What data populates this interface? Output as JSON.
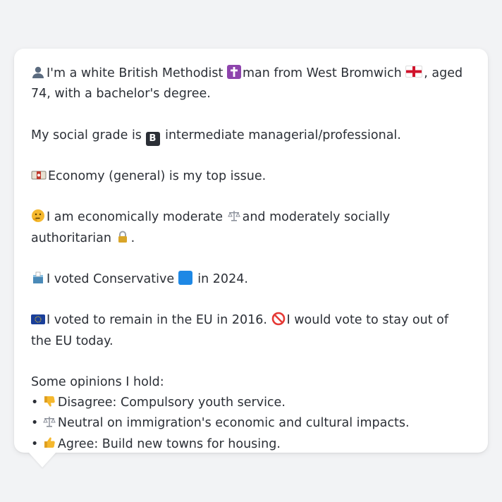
{
  "persona": {
    "line1_pre": "I'm a white British Methodist",
    "line1_mid": "man from West Bromwich",
    "line1_post": ", aged 74, with a bachelor's degree.",
    "social_grade_pre": "My social grade is",
    "social_grade_post": "intermediate managerial/professional.",
    "top_issue": "Economy (general) is my top issue.",
    "ideology_pre": "I am economically moderate",
    "ideology_mid": "and moderately socially authoritarian",
    "ideology_post": ".",
    "vote_pre": "I voted Conservative",
    "vote_post": "in 2024.",
    "eu_pre": "I voted to remain in the EU in 2016.",
    "eu_post": "I would vote to stay out of the EU today.",
    "opinions_title": "Some opinions I hold:",
    "opinions": [
      {
        "bullet": "•",
        "text": "Disagree: Compulsory youth service."
      },
      {
        "bullet": "•",
        "text": "Neutral on immigration's economic and cultural impacts."
      },
      {
        "bullet": "•",
        "text": "Agree: Build new towns for housing."
      }
    ]
  },
  "icons": {
    "person": "bust-in-silhouette-icon",
    "cross": "latin-cross-icon",
    "flag": "england-flag-icon",
    "grade": "b-button-icon",
    "economy": "money-icon",
    "thinking": "thinking-face-icon",
    "scales": "balance-scale-icon",
    "lock": "lock-icon",
    "ballot": "ballot-box-icon",
    "party": "blue-square-icon",
    "eu": "eu-flag-icon",
    "prohibited": "prohibited-icon",
    "thumbs_down": "thumbs-down-icon",
    "thumbs_up": "thumbs-up-icon"
  },
  "colors": {
    "background": "#f2f3f5",
    "card": "#ffffff",
    "text": "#2b2f36",
    "conservative_blue": "#1e88e5",
    "eu_blue": "#1a3f9a",
    "cross_purple": "#8e44ad"
  }
}
